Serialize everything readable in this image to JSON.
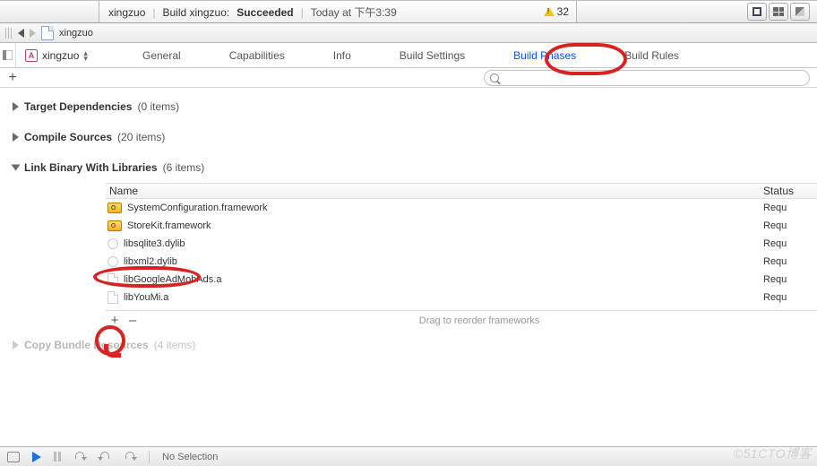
{
  "status_bar": {
    "scheme": "xingzuo",
    "build_prefix": "Build xingzuo:",
    "build_result": "Succeeded",
    "time": "Today at 下午3:39",
    "warning_count": "32"
  },
  "path_bar": {
    "file_name": "xingzuo"
  },
  "project": {
    "name": "xingzuo"
  },
  "tabs": {
    "items": [
      {
        "label": "General",
        "selected": false
      },
      {
        "label": "Capabilities",
        "selected": false
      },
      {
        "label": "Info",
        "selected": false
      },
      {
        "label": "Build Settings",
        "selected": false
      },
      {
        "label": "Build Phases",
        "selected": true
      },
      {
        "label": "Build Rules",
        "selected": false
      }
    ]
  },
  "search": {
    "placeholder": ""
  },
  "phases": {
    "target_deps": {
      "title": "Target Dependencies",
      "count": "(0 items)",
      "open": false
    },
    "compile": {
      "title": "Compile Sources",
      "count": "(20 items)",
      "open": false
    },
    "link": {
      "title": "Link Binary With Libraries",
      "count": "(6 items)",
      "open": true
    },
    "copy": {
      "title": "Copy Bundle Resources",
      "count": "(4 items)",
      "open": false
    }
  },
  "link_table": {
    "col_name": "Name",
    "col_status": "Status",
    "rows": [
      {
        "name": "SystemConfiguration.framework",
        "type": "framework",
        "status": "Requ"
      },
      {
        "name": "StoreKit.framework",
        "type": "framework",
        "status": "Requ"
      },
      {
        "name": "libsqlite3.dylib",
        "type": "dylib",
        "status": "Requ"
      },
      {
        "name": "libxml2.dylib",
        "type": "dylib",
        "status": "Requ"
      },
      {
        "name": "libGoogleAdMobAds.a",
        "type": "afile",
        "status": "Requ"
      },
      {
        "name": "libYouMi.a",
        "type": "afile",
        "status": "Requ"
      }
    ],
    "footer_hint": "Drag to reorder frameworks"
  },
  "debug_bar": {
    "selection": "No Selection"
  },
  "watermark": "©51CTO博客"
}
